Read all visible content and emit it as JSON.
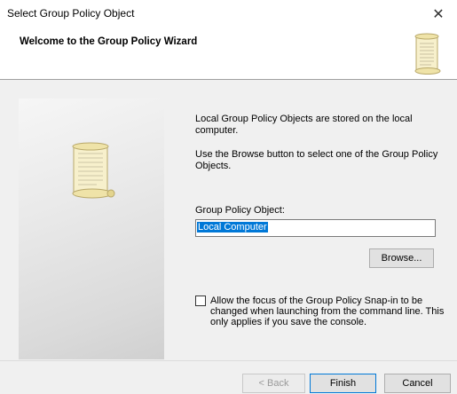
{
  "window": {
    "title": "Select Group Policy Object",
    "close_glyph": "✕"
  },
  "header": {
    "title": "Welcome to the Group Policy Wizard",
    "icon": "scroll-icon"
  },
  "main": {
    "description_1": "Local Group Policy Objects are stored on the local computer.",
    "description_2": "Use the Browse button to select one of the Group Policy Objects.",
    "gpo_label": "Group Policy Object:",
    "gpo_value": "Local Computer",
    "browse_label": "Browse...",
    "checkbox_checked": false,
    "checkbox_label": "Allow the focus of the Group Policy Snap-in to be changed when launching from the command line.  This only applies if you save the console."
  },
  "footer": {
    "back_label": "< Back",
    "finish_label": "Finish",
    "cancel_label": "Cancel"
  },
  "colors": {
    "selection": "#0078d7",
    "dialog_bg": "#f0f0f0",
    "scroll_parchment": "#f4ecc2"
  }
}
